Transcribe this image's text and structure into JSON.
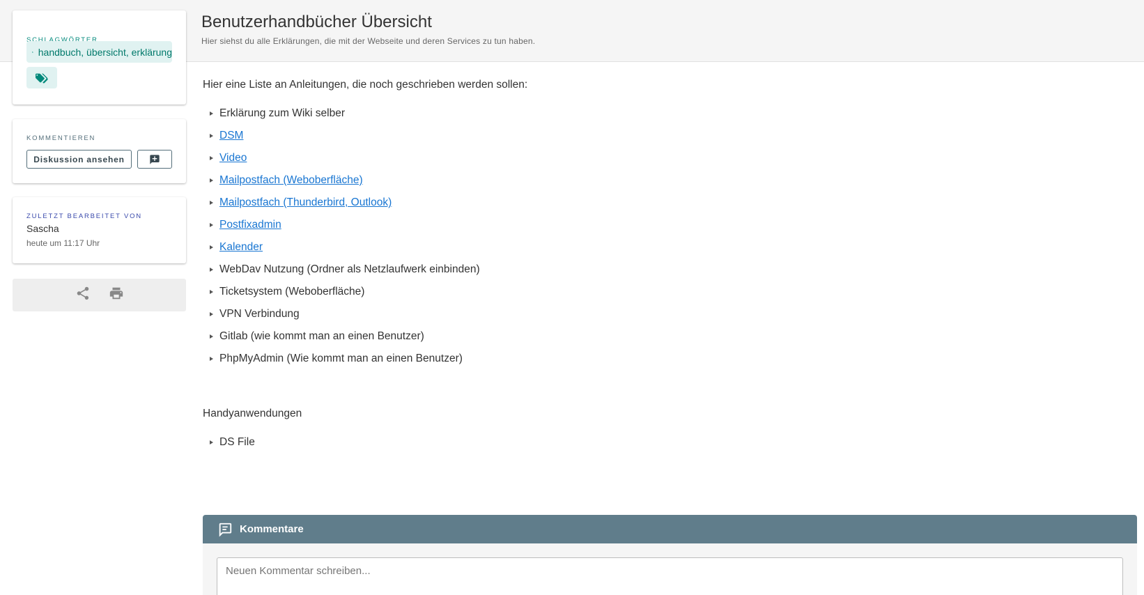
{
  "header": {
    "title": "Benutzerhandbücher Übersicht",
    "subtitle": "Hier siehst du alle Erklärungen, die mit der Webseite und deren Services zu tun haben."
  },
  "sidebar": {
    "tags": {
      "label": "SCHLAGWÖRTER",
      "chip_text": "handbuch, übersicht, erklärung"
    },
    "comment": {
      "label": "KOMMENTIEREN",
      "discuss_button": "Diskussion ansehen"
    },
    "edited": {
      "label": "ZULETZT BEARBEITET VON",
      "name": "Sascha",
      "time": "heute um 11:17 Uhr"
    }
  },
  "content": {
    "intro": "Hier eine Liste an Anleitungen, die noch geschrieben werden sollen:",
    "items": [
      {
        "text": "Erklärung zum Wiki selber",
        "link": false
      },
      {
        "text": "DSM",
        "link": true
      },
      {
        "text": "Video",
        "link": true
      },
      {
        "text": "Mailpostfach (Weboberfläche)",
        "link": true
      },
      {
        "text": "Mailpostfach (Thunderbird, Outlook)",
        "link": true
      },
      {
        "text": "Postfixadmin",
        "link": true
      },
      {
        "text": "Kalender",
        "link": true
      },
      {
        "text": "WebDav Nutzung (Ordner als Netzlaufwerk einbinden)",
        "link": false
      },
      {
        "text": "Ticketsystem (Weboberfläche)",
        "link": false
      },
      {
        "text": "VPN Verbindung",
        "link": false
      },
      {
        "text": "Gitlab (wie kommt man an einen Benutzer)",
        "link": false
      },
      {
        "text": "PhpMyAdmin (Wie kommt man an einen Benutzer)",
        "link": false
      }
    ],
    "section2_title": "Handyanwendungen",
    "section2_items": [
      {
        "text": "DS File",
        "link": false
      }
    ]
  },
  "comments": {
    "title": "Kommentare",
    "placeholder": "Neuen Kommentar schreiben..."
  },
  "icons": {
    "tag": "tag-icon",
    "tags": "tags-icon",
    "comment_add": "comment-plus-icon",
    "share": "share-icon",
    "print": "printer-icon",
    "comments": "comment-text-icon"
  },
  "colors": {
    "teal": "#00897b",
    "teal_light": "#e0f2f1",
    "blue_grey": "#607d8b",
    "indigo": "#3949ab",
    "link": "#1976d2"
  }
}
